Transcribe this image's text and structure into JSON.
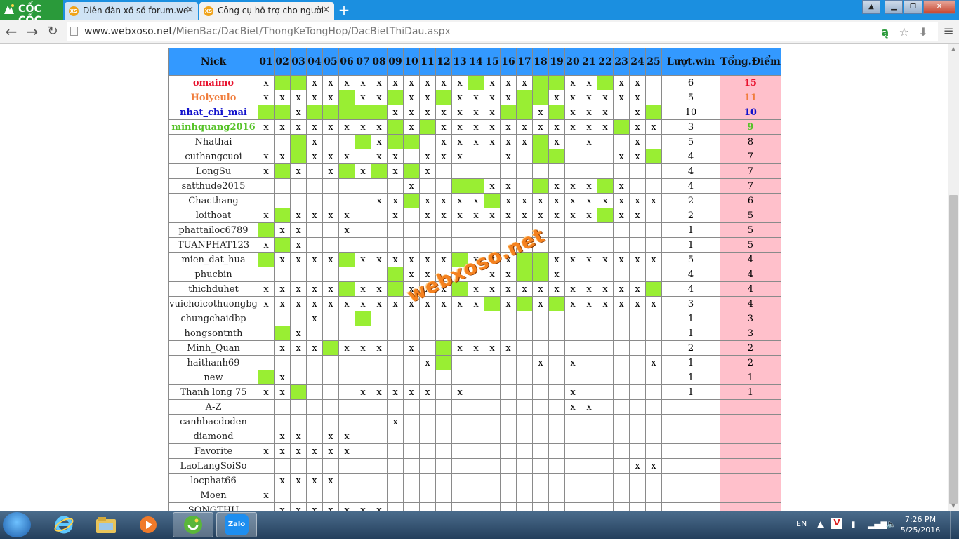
{
  "browser": {
    "brand": "CỐC CỐC",
    "tabs": [
      {
        "title": "Diễn đàn xổ số forum.web",
        "favicon": "XS",
        "active": false
      },
      {
        "title": "Công cụ hỗ trợ cho người",
        "favicon": "XS",
        "active": true
      }
    ],
    "url_host": "www.webxoso.net",
    "url_path": "/MienBac/DacBiet/ThongKeTongHop/DacBietThiDau.aspx"
  },
  "table": {
    "headers": [
      "Nick",
      "01",
      "02",
      "03",
      "04",
      "05",
      "06",
      "07",
      "08",
      "09",
      "10",
      "11",
      "12",
      "13",
      "14",
      "15",
      "16",
      "17",
      "18",
      "19",
      "20",
      "21",
      "22",
      "23",
      "24",
      "25",
      "Lượt.win",
      "Tổng.Điểm"
    ],
    "rows": [
      {
        "nick": "omaimo",
        "cells": "xggxxxxxxxxxxgxxxggxxgxx",
        "wins": "6",
        "points": "15"
      },
      {
        "nick": "Hoiyeulo",
        "cells": "xxxxxgxxgxxgxxxxggxxxxxx",
        "wins": "5",
        "points": "11"
      },
      {
        "nick": "nhat_chi_mai",
        "cells": "ggxgggggxxxxxxxggxgxxx.xg",
        "wins": "10",
        "points": "10"
      },
      {
        "nick": "minhquang2016",
        "cells": "xxxxxxxxgxgxxxxxxxxxxxgxx",
        "wins": "3",
        "points": "9"
      },
      {
        "nick": "Nhathai",
        "cells": "..gx..gxgg.xxxxxxgx.x..x.",
        "wins": "5",
        "points": "8"
      },
      {
        "nick": "cuthangcuoi",
        "cells": "xxgxxx.xx.xxx..x.gg...xxg",
        "wins": "4",
        "points": "7"
      },
      {
        "nick": "LongSu",
        "cells": "xgx.xgxgxgx..............",
        "wins": "4",
        "points": "7"
      },
      {
        "nick": "satthude2015",
        "cells": ".........x..ggxx.gxxxgx..",
        "wins": "4",
        "points": "7"
      },
      {
        "nick": "Chacthang",
        "cells": ".......xxgxxxxgxxxxxxxxxx",
        "wins": "2",
        "points": "6"
      },
      {
        "nick": "loithoat",
        "cells": "xgxxxx..x.xxxxxxxxxxxgxx.",
        "wins": "2",
        "points": "5"
      },
      {
        "nick": "phattailoc6789",
        "cells": "gxx..x...................",
        "wins": "1",
        "points": "5"
      },
      {
        "nick": "TUANPHAT123",
        "cells": "xgx......................",
        "wins": "1",
        "points": "5"
      },
      {
        "nick": "mien_dat_hua",
        "cells": "gxxxxgxxxxxxgxxxggxxxxxxx",
        "wins": "5",
        "points": "4"
      },
      {
        "nick": "phucbin",
        "cells": "........gxx...xxggx......",
        "wins": "4",
        "points": "4"
      },
      {
        "nick": "thichduhet",
        "cells": "xxxxxgxxgxxxgxxxxxxxxxxxg",
        "wins": "4",
        "points": "4"
      },
      {
        "nick": "vuichoicothuongbg",
        "cells": "xxxxxxxxxxxxxxgxgxgxxxxxx",
        "wins": "3",
        "points": "4"
      },
      {
        "nick": "chungchaidbp",
        "cells": "...x..g..................",
        "wins": "1",
        "points": "3"
      },
      {
        "nick": "hongsontnth",
        "cells": ".gx......................",
        "wins": "1",
        "points": "3"
      },
      {
        "nick": "Minh_Quan",
        "cells": ".xxxgxxx.x.gxxxx.........",
        "wins": "2",
        "points": "2"
      },
      {
        "nick": "haithanh69",
        "cells": "..........xg.....x.x....x",
        "wins": "1",
        "points": "2"
      },
      {
        "nick": "new",
        "cells": "gx.......................",
        "wins": "1",
        "points": "1"
      },
      {
        "nick": "Thanh long 75",
        "cells": "xxg...xxxxx.x......x.....",
        "wins": "1",
        "points": "1"
      },
      {
        "nick": "A-Z",
        "cells": "...................xx....",
        "wins": "",
        "points": ""
      },
      {
        "nick": "canhbacdoden",
        "cells": "........x................",
        "wins": "",
        "points": ""
      },
      {
        "nick": "diamond",
        "cells": ".xx.xx...................",
        "wins": "",
        "points": ""
      },
      {
        "nick": "Favorite",
        "cells": "xxxxxx...................",
        "wins": "",
        "points": ""
      },
      {
        "nick": "LaoLangSoiSo",
        "cells": ".......................xx",
        "wins": "",
        "points": ""
      },
      {
        "nick": "locphat66",
        "cells": ".xxxx....................",
        "wins": "",
        "points": ""
      },
      {
        "nick": "Moen",
        "cells": "x........................",
        "wins": "",
        "points": ""
      },
      {
        "nick": "SONGTHU",
        "cells": ".xxxxxxx.................",
        "wins": "",
        "points": ""
      }
    ],
    "mark": "x",
    "colors": {
      "header_bg": "#3399ff",
      "green": "#99ee33",
      "points_bg": "#ffc0cb"
    }
  },
  "watermark": "webxoso.net",
  "taskbar": {
    "apps": [
      "ie-icon",
      "explorer-icon",
      "media-player-icon",
      "coccoc-icon",
      "zalo-icon"
    ],
    "zalo_label": "Zalo",
    "lang": "EN",
    "time": "7:26 PM",
    "date": "5/25/2016"
  }
}
